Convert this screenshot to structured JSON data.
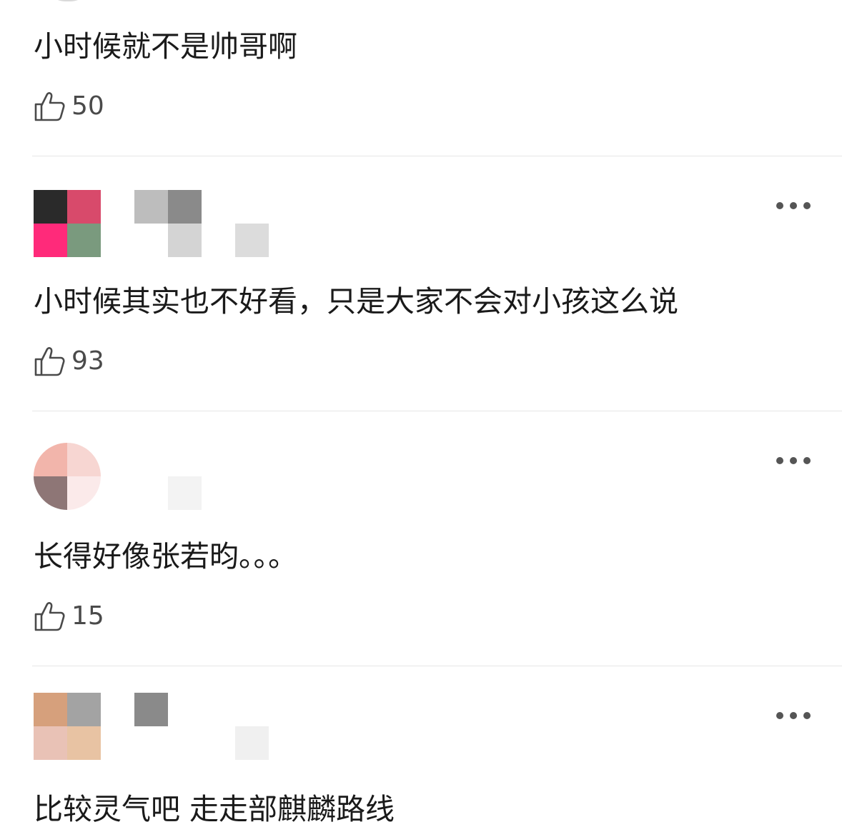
{
  "comments": [
    {
      "text": "小时候就不是帅哥啊",
      "likes": "50"
    },
    {
      "text": "小时候其实也不好看，只是大家不会对小孩这么说",
      "likes": "93"
    },
    {
      "text": "长得好像张若昀。。。",
      "likes": "15"
    },
    {
      "text": "比较灵气吧 走走部麒麟路线",
      "likes": ""
    }
  ],
  "icons": {
    "like": "thumbs-up-icon",
    "more": "more-options-icon"
  },
  "colors": {
    "text": "#1a1a1a",
    "like_count": "#4a4a4a",
    "divider": "#e6e6e6",
    "more_dots": "#555555"
  }
}
